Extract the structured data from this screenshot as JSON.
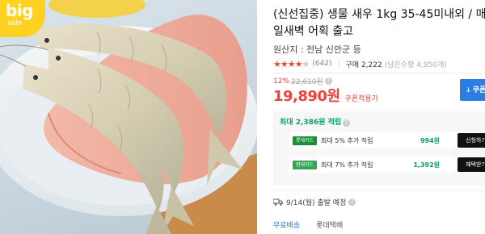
{
  "badge": {
    "big": "big",
    "sale": "sale"
  },
  "product": {
    "title": "(신선집중) 생물 새우 1kg 35-45미내외 / 매일새벽 어획 출고",
    "origin": "원산지 : 전남 신안군 등",
    "rating_stars": 4.5,
    "review_count": "(642)",
    "purchases": "구매 2,222",
    "remaining": "(남은수량 4,950개)",
    "discount_rate": "12%",
    "original_price": "22,610원",
    "price": "19,890원",
    "coupon_label": "쿠폰적용가",
    "coupon_button": "쿠폰"
  },
  "points": {
    "max_label": "최대 2,386원 적립",
    "cards": [
      {
        "icon_text": "롯데카드",
        "desc": "최대 5% 추가 적립",
        "amount": "994원",
        "button": "신청하기"
      },
      {
        "icon_text": "현대카드",
        "desc": "최대 7% 추가 적립",
        "amount": "1,392원",
        "button": "혜택받기"
      }
    ]
  },
  "shipping": {
    "date": "9/14(월) 출발 예정",
    "fee": "무료배송",
    "carrier": "롯데택배"
  },
  "colors": {
    "accent_red": "#e8453c",
    "green": "#0a9e6c",
    "blue": "#2a7de1",
    "badge_yellow": "#ffd21f"
  }
}
